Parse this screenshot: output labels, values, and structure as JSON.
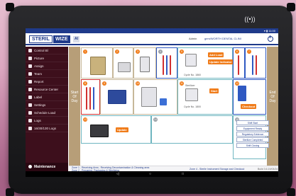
{
  "device": {
    "nfc_symbol": "((•))"
  },
  "status_bar": {
    "text": "▾ ▮ 11:00"
  },
  "header": {
    "brand_left": "STERIL",
    "brand_right": "WIZE",
    "brand_badge": "AI",
    "user": "Admin",
    "clinic": "gem/WORTH DENTAL CLINI"
  },
  "sidebar": {
    "items": [
      {
        "label": "Control Bl",
        "icon": "control-icon"
      },
      {
        "label": "Picture",
        "icon": "picture-icon"
      },
      {
        "label": "Assign",
        "icon": "assign-icon"
      },
      {
        "label": "Team",
        "icon": "team-icon"
      },
      {
        "label": "Report",
        "icon": "report-icon"
      },
      {
        "label": "Resource Center",
        "icon": "resource-icon"
      },
      {
        "label": "Label",
        "icon": "label-icon"
      },
      {
        "label": "Settings",
        "icon": "gear-icon"
      },
      {
        "label": "Schedule Load",
        "icon": "clock-icon"
      },
      {
        "label": "Logs",
        "icon": "logs-icon"
      },
      {
        "label": "16/30/130 Logs",
        "icon": "logs-icon"
      }
    ],
    "maintenance": "Maintenance",
    "version": "Version: R7 T.50"
  },
  "board": {
    "start_label": "Start Of Day",
    "end_label": "End Of Day",
    "buttons": {
      "add_load": "Add Load",
      "update_indicator": "Update Indicator",
      "start": "Start",
      "checkout": "Checkout",
      "update": "Update"
    },
    "captions": {
      "cycle_left": "Cycle No. 1860",
      "cycle_right": "Cycle No. 1800",
      "sterilizer": "Sterilizer"
    },
    "badges": [
      "1",
      "2",
      "3",
      "4",
      "5",
      "6",
      "7",
      "8",
      "9",
      "10",
      "11",
      "12",
      "13",
      "14",
      "15",
      "16"
    ],
    "reports": [
      "Shift Start",
      "Equipment Ready",
      "Regulatory Evidence",
      "Sterilize Completed",
      "Shift Closing"
    ]
  },
  "zones": {
    "zone1": "Zone 1 - Receiving Area - Receiving Decontamination & Cleaning area",
    "zone1b": "Zone 2 - Preparing, Packaging & Sterilizing",
    "zone2": "Zone 4 - Sterile Instrument Storage and Checkout",
    "build": "Build 3.6.19/03/24"
  },
  "colors": {
    "sidebar": "#3d0f1c",
    "brand": "#1f3a8a",
    "accent": "#f07c1a",
    "lane_bg": "#b79e78",
    "blue_border": "#2f59c2",
    "red_border": "#d23030"
  }
}
